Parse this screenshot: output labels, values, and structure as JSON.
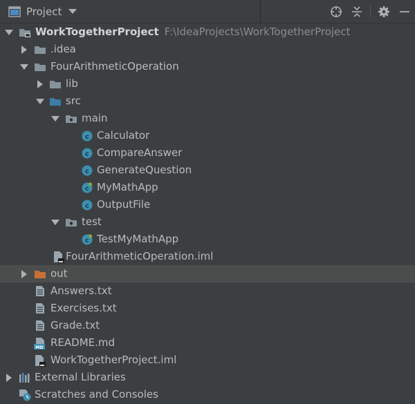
{
  "header": {
    "title": "Project",
    "tools": [
      "locate-icon",
      "collapse-all-icon",
      "gear-icon",
      "minimize-icon"
    ]
  },
  "tree": [
    {
      "id": "root",
      "label": "WorkTogetherProject",
      "path": "F:\\IdeaProjects\\WorkTogetherProject",
      "icon": "module-folder-icon",
      "arrow": "down",
      "depth": 0
    },
    {
      "id": "idea",
      "label": ".idea",
      "icon": "folder-icon",
      "arrow": "right",
      "depth": 1
    },
    {
      "id": "fao",
      "label": "FourArithmeticOperation",
      "icon": "folder-icon",
      "arrow": "down",
      "depth": 1
    },
    {
      "id": "lib",
      "label": "lib",
      "icon": "folder-icon",
      "arrow": "right",
      "depth": 2
    },
    {
      "id": "src",
      "label": "src",
      "icon": "source-folder-icon",
      "arrow": "down",
      "depth": 2
    },
    {
      "id": "main",
      "label": "main",
      "icon": "package-folder-icon",
      "arrow": "down",
      "depth": 3
    },
    {
      "id": "calculator",
      "label": "Calculator",
      "icon": "java-class-icon",
      "depth": 4
    },
    {
      "id": "compare",
      "label": "CompareAnswer",
      "icon": "java-class-icon",
      "depth": 4
    },
    {
      "id": "generate",
      "label": "GenerateQuestion",
      "icon": "java-class-icon",
      "depth": 4
    },
    {
      "id": "mymathapp",
      "label": "MyMathApp",
      "icon": "java-main-class-icon",
      "depth": 4
    },
    {
      "id": "outputfile",
      "label": "OutputFile",
      "icon": "java-class-icon",
      "depth": 4
    },
    {
      "id": "test",
      "label": "test",
      "icon": "package-folder-icon",
      "arrow": "down",
      "depth": 3
    },
    {
      "id": "testmymathapp",
      "label": "TestMyMathApp",
      "icon": "java-main-class-icon",
      "depth": 4
    },
    {
      "id": "faoiml",
      "label": "FourArithmeticOperation.iml",
      "icon": "iml-file-icon",
      "depth": 2
    },
    {
      "id": "out",
      "label": "out",
      "icon": "excluded-folder-icon",
      "arrow": "right",
      "depth": 1,
      "selected": true
    },
    {
      "id": "answers",
      "label": "Answers.txt",
      "icon": "text-file-icon",
      "depth": 1
    },
    {
      "id": "exercises",
      "label": "Exercises.txt",
      "icon": "text-file-icon",
      "depth": 1
    },
    {
      "id": "grade",
      "label": "Grade.txt",
      "icon": "text-file-icon",
      "depth": 1
    },
    {
      "id": "readme",
      "label": "README.md",
      "icon": "markdown-file-icon",
      "depth": 1
    },
    {
      "id": "wtpiml",
      "label": "WorkTogetherProject.iml",
      "icon": "iml-file-icon",
      "depth": 1
    },
    {
      "id": "extlib",
      "label": "External Libraries",
      "icon": "libraries-icon",
      "arrow": "right",
      "depth": 0
    },
    {
      "id": "scratches",
      "label": "Scratches and Consoles",
      "icon": "scratches-icon",
      "depth": 0
    }
  ],
  "colors": {
    "background": "#3c3f41",
    "selection": "#4b4d4d",
    "text": "#bbbbbb",
    "path_text": "#8c8c8c",
    "folder": "#87939a",
    "source_folder": "#3b7ca8",
    "excluded_folder": "#c87137",
    "java_class": "#3d8fb0"
  }
}
